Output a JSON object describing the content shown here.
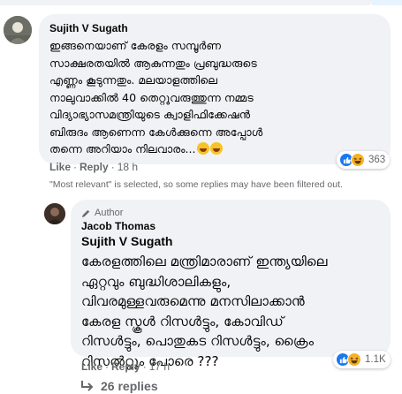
{
  "comment1": {
    "author": "Sujith V Sugath",
    "text": "ഇങ്ങനെയാണ് കേരളം സമ്പൂർണ\nസാക്ഷരതയിൽ ആകുന്നതും പ്രബുദ്ധരുടെ\nഎണ്ണം കൂടുന്നതും. മലയാളത്തിലെ\nനാലുവാക്കിൽ 40 തെറ്റുവരുത്തുന്ന നമ്മട\nവിദ്യാഭ്യാസമന്ത്രിയുടെ ക്വാളിഫിക്കേഷൻ\nബിരുദം ആണെന്ന കേൾക്കുന്നെ അപ്പോൾ\nതന്നെ അറിയാം നിലവാരം...",
    "like_label": "Like",
    "reply_label": "Reply",
    "time": "18 h",
    "reaction_count": "363",
    "emojis": [
      "rofl-emoji",
      "rofl-emoji"
    ]
  },
  "filter_note": "\"Most relevant\" is selected, so some replies may have been filtered out.",
  "reply1": {
    "badge": "Author",
    "author": "Jacob Thomas",
    "mention": "Sujith V Sugath",
    "text": "കേരളത്തിലെ മന്ത്രിമാരാണ് ഇന്ത്യയിലെ\nഏറ്റവും ബുദ്ധിശാലികളും,\nവിവരമുള്ളവരുമെന്നു മനസിലാക്കാൻ\nകേരള സ്കൂൾ റിസൾട്ടും, കോവിഡ്\nറിസൾട്ടും, പൊതുകട റിസൾട്ടും, ക്രൈം\nറിസൽറ്റും പോരെ ???",
    "like_label": "Like",
    "reply_label": "Reply",
    "time": "17 h",
    "reaction_count": "1.1K"
  },
  "replies_link": "26 replies",
  "colors": {
    "bubble": "#f0f2f5",
    "meta": "#65676b",
    "like_blue": "#1877f2",
    "haha_yellow": "#f7b125"
  }
}
